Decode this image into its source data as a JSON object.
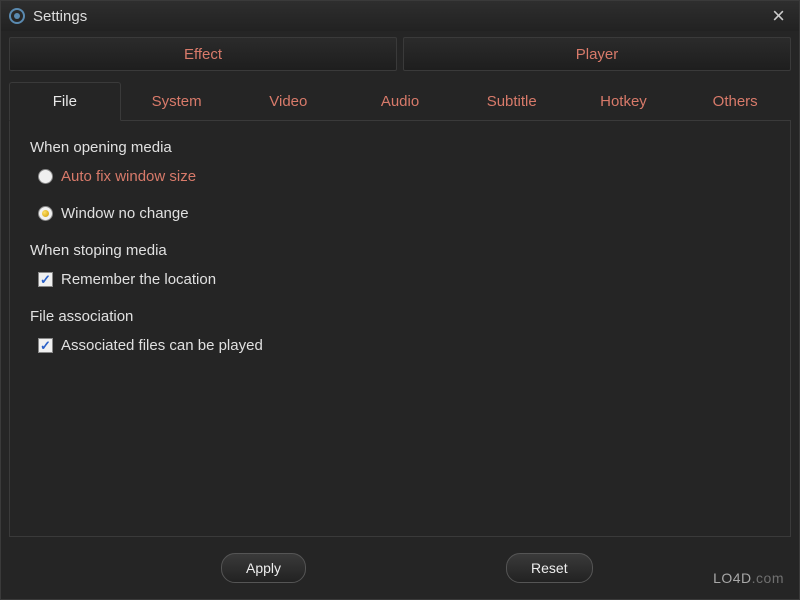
{
  "window": {
    "title": "Settings"
  },
  "primaryTabs": {
    "effect": "Effect",
    "player": "Player"
  },
  "secondaryTabs": {
    "file": "File",
    "system": "System",
    "video": "Video",
    "audio": "Audio",
    "subtitle": "Subtitle",
    "hotkey": "Hotkey",
    "others": "Others"
  },
  "sections": {
    "opening": {
      "heading": "When opening media",
      "opt_auto": "Auto fix window size",
      "opt_nochange": "Window no change"
    },
    "stopping": {
      "heading": "When stoping media",
      "opt_remember": "Remember the location"
    },
    "assoc": {
      "heading": "File association",
      "opt_assoc": "Associated files can be played"
    }
  },
  "buttons": {
    "apply": "Apply",
    "reset": "Reset"
  },
  "watermark": {
    "a": "LO4D",
    "b": ".com"
  }
}
